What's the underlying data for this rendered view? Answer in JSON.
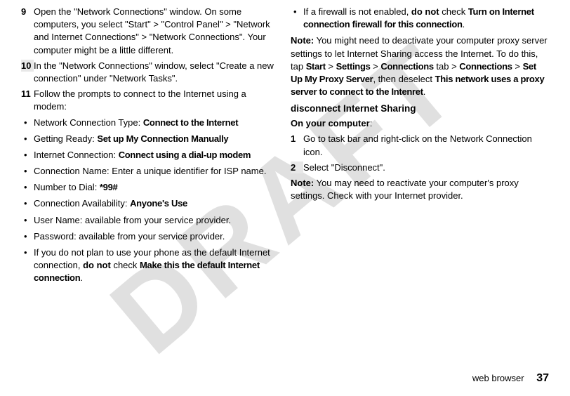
{
  "watermark": "DRAFT",
  "left": {
    "step9": {
      "num": "9",
      "text": "Open the \"Network Connections\" window. On some computers, you select \"Start\" > \"Control Panel\" > \"Network and Internet Connections\" > \"Network Connections\". Your computer might be a little different."
    },
    "step10": {
      "num": "10",
      "text": "In the \"Network Connections\" window, select \"Create a new connection\" under \"Network Tasks\"."
    },
    "step11": {
      "num": "11",
      "text": "Follow the prompts to connect to the Internet using a modem:"
    },
    "b1": {
      "label": "Network Connection Type: ",
      "bold": "Connect to the Internet"
    },
    "b2": {
      "label": "Getting Ready: ",
      "bold": "Set up My Connection Manually"
    },
    "b3": {
      "label": "Internet Connection: ",
      "bold": "Connect using a dial-up modem"
    },
    "b4": {
      "text": "Connection Name: Enter a unique identifier for ISP name."
    },
    "b5": {
      "label": "Number to Dial: ",
      "bold": "*99#"
    },
    "b6": {
      "label": "Connection Availability: ",
      "bold": "Anyone's Use"
    },
    "b7": {
      "text": "User Name: available from your service provider."
    },
    "b8": {
      "text": "Password: available from your service provider."
    },
    "b9": {
      "pre": "If you do not plan to use your phone as the default Internet connection, ",
      "bold1": "do not",
      "mid": " check ",
      "cond": "Make this the default Internet connection",
      "post": "."
    }
  },
  "right": {
    "b1": {
      "pre": "If a firewall is not enabled, ",
      "bold1": "do not",
      "mid": " check ",
      "cond": "Turn on Internet connection firewall for this connection",
      "post": "."
    },
    "note1": {
      "label": "Note:",
      "t1": " You might need to deactivate your computer proxy server settings to let Internet Sharing access the Internet. To do this, tap ",
      "c1": "Start",
      "g1": " > ",
      "c2": "Settings",
      "g2": " > ",
      "c3": "Connections",
      "t2": " tab > ",
      "c4": "Connections",
      "g3": " > ",
      "c5": "Set Up My Proxy Server",
      "t3": ", then deselect ",
      "c6": "This network uses a proxy server to connect to the Intenret",
      "t4": "."
    },
    "heading": "disconnect Internet Sharing",
    "oyc": "On your computer",
    "step1": {
      "num": "1",
      "text": "Go to task bar and right-click on the Network Connection icon."
    },
    "step2": {
      "num": "2",
      "text": "Select \"Disconnect\"."
    },
    "note2": {
      "label": "Note:",
      "text": " You may need to reactivate your computer's proxy settings. Check with your Internet provider."
    }
  },
  "footer": {
    "section": "web browser",
    "page": "37"
  }
}
